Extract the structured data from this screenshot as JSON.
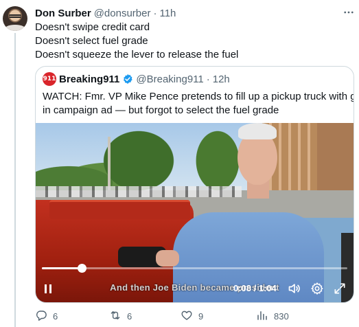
{
  "author": {
    "name": "Don Surber",
    "handle": "@donsurber",
    "dot": "·",
    "time": "11h"
  },
  "body_lines": [
    "Doesn't swipe credit card",
    "Doesn't select fuel grade",
    "Doesn't squeeze the lever to release the fuel"
  ],
  "quoted": {
    "logo_text": "911",
    "name": "Breaking911",
    "handle": "@Breaking911",
    "dot": "·",
    "time": "12h",
    "text_lines": [
      "WATCH: Fmr. VP Mike Pence pretends to fill up a pickup truck with gas",
      "in campaign ad — but forgot to select the fuel grade"
    ],
    "video": {
      "caption": "And then Joe Biden became president",
      "timecode": "0:08 / 1:04",
      "progress": 0.13
    }
  },
  "actions": {
    "replies": "6",
    "retweets": "6",
    "likes": "9",
    "views": "830"
  },
  "colors": {
    "text": "#0f1419",
    "secondary": "#536471",
    "border": "#cfd9de",
    "verified": "#1d9bf0",
    "breaking_red": "#d9252b"
  },
  "icons": {
    "more": "more-icon",
    "verified": "verified-badge-icon",
    "pause": "pause-icon",
    "volume": "volume-icon",
    "settings": "gear-icon",
    "fullscreen": "expand-icon",
    "reply": "reply-icon",
    "retweet": "retweet-icon",
    "like": "heart-icon",
    "views": "views-icon"
  }
}
